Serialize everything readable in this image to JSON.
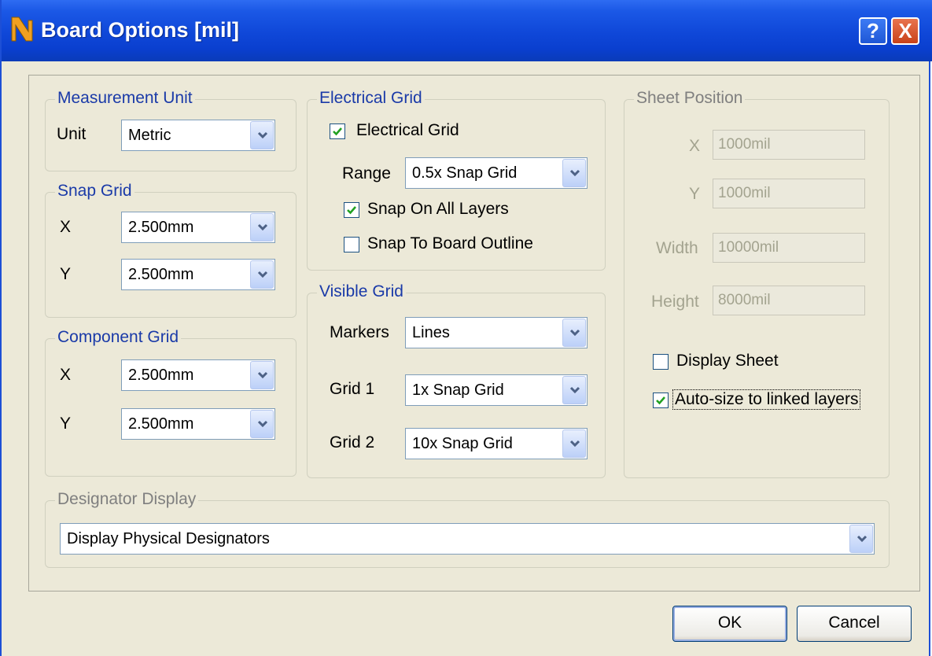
{
  "window": {
    "title": "Board Options [mil]",
    "help_label": "?",
    "close_label": "X"
  },
  "measurement": {
    "legend": "Measurement Unit",
    "unit_label": "Unit",
    "unit_value": "Metric"
  },
  "snap_grid": {
    "legend": "Snap Grid",
    "x_label": "X",
    "x_value": "2.500mm",
    "y_label": "Y",
    "y_value": "2.500mm"
  },
  "component_grid": {
    "legend": "Component Grid",
    "x_label": "X",
    "x_value": "2.500mm",
    "y_label": "Y",
    "y_value": "2.500mm"
  },
  "electrical_grid": {
    "legend": "Electrical Grid",
    "enable_label": "Electrical Grid",
    "enable_checked": true,
    "range_label": "Range",
    "range_value": "0.5x Snap Grid",
    "snap_all_label": "Snap On All Layers",
    "snap_all_checked": true,
    "snap_outline_label": "Snap To Board Outline",
    "snap_outline_checked": false
  },
  "visible_grid": {
    "legend": "Visible Grid",
    "markers_label": "Markers",
    "markers_value": "Lines",
    "grid1_label": "Grid 1",
    "grid1_value": "1x Snap Grid",
    "grid2_label": "Grid 2",
    "grid2_value": "10x Snap Grid"
  },
  "sheet_position": {
    "legend": "Sheet Position",
    "x_label": "X",
    "x_value": "1000mil",
    "y_label": "Y",
    "y_value": "1000mil",
    "width_label": "Width",
    "width_value": "10000mil",
    "height_label": "Height",
    "height_value": "8000mil",
    "display_sheet_label": "Display Sheet",
    "display_sheet_checked": false,
    "autosize_label": "Auto-size to linked layers",
    "autosize_checked": true
  },
  "designator": {
    "legend": "Designator Display",
    "value": "Display Physical Designators"
  },
  "buttons": {
    "ok": "OK",
    "cancel": "Cancel"
  },
  "colors": {
    "titlebar": "#0a3fcf",
    "dialog_bg": "#ece9d8",
    "legend_text": "#1a3aa8",
    "check_mark": "#21a121"
  }
}
